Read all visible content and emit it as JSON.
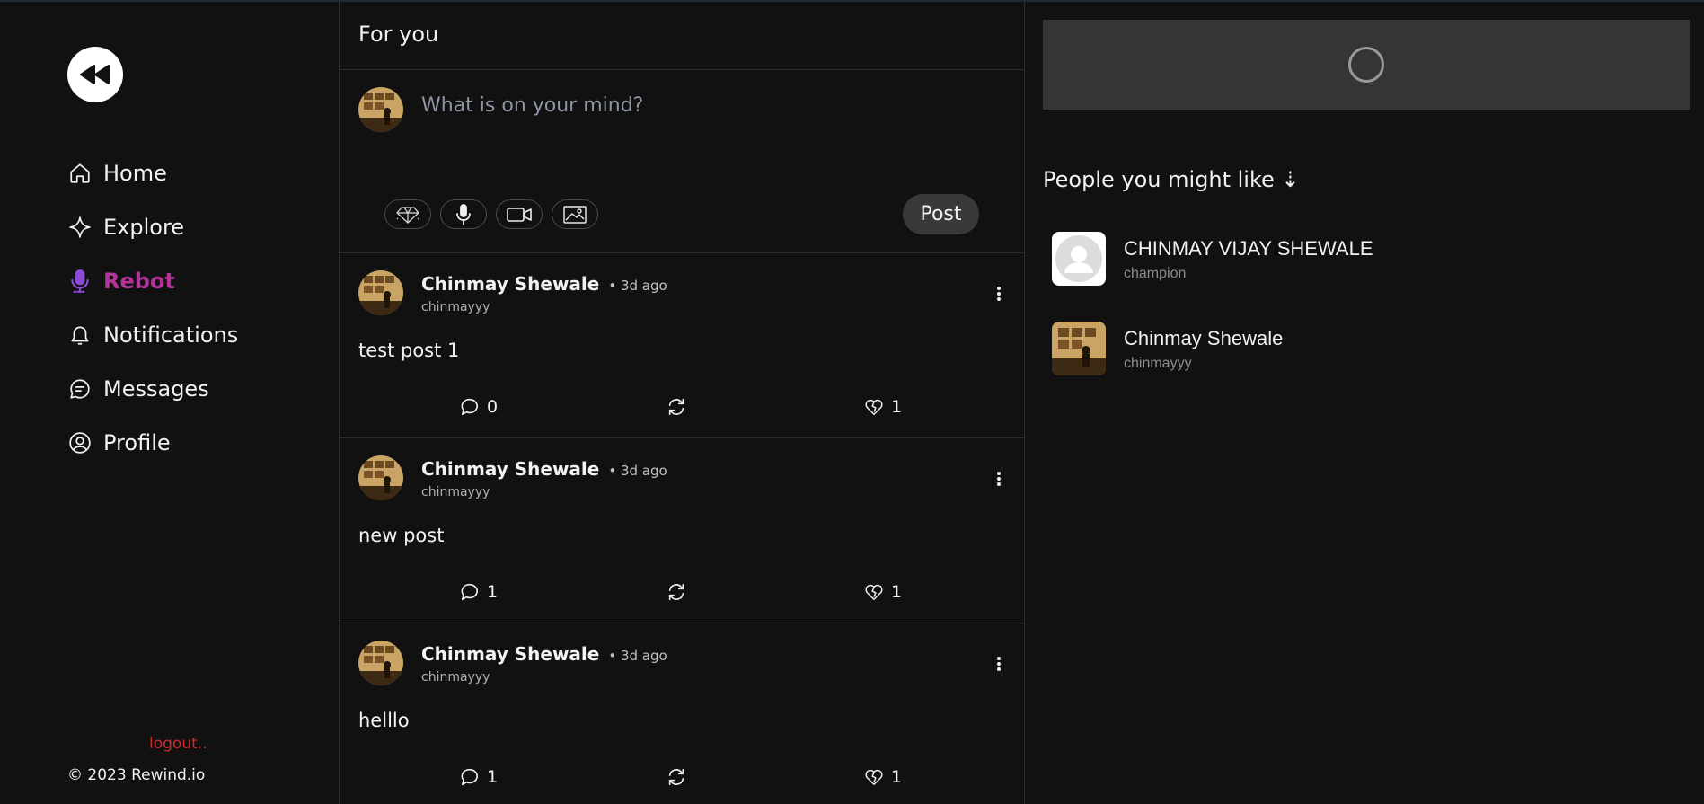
{
  "theme": {
    "background": "#111111",
    "accent": "#b3339a",
    "mic_accent": "#8a4bd6",
    "danger": "#d22a2a"
  },
  "sidebar": {
    "logo_icon": "rewind-icon",
    "items": [
      {
        "label": "Home",
        "icon": "home-icon",
        "active": false
      },
      {
        "label": "Explore",
        "icon": "sparkle-icon",
        "active": false
      },
      {
        "label": "Rebot",
        "icon": "microphone-icon",
        "active": true
      },
      {
        "label": "Notifications",
        "icon": "bell-icon",
        "active": false
      },
      {
        "label": "Messages",
        "icon": "message-icon",
        "active": false
      },
      {
        "label": "Profile",
        "icon": "user-circle-icon",
        "active": false
      }
    ],
    "logout_label": "logout..",
    "copyright": "© 2023 Rewind.io"
  },
  "feed": {
    "header_title": "For you",
    "composer": {
      "placeholder": "What is on your mind?",
      "tools": [
        "gem-icon",
        "microphone-icon",
        "video-icon",
        "image-icon"
      ],
      "post_label": "Post"
    },
    "posts": [
      {
        "name": "Chinmay Shewale",
        "time": "• 3d ago",
        "handle": "chinmayyy",
        "body": "test post 1",
        "comments": "0",
        "likes": "1"
      },
      {
        "name": "Chinmay Shewale",
        "time": "• 3d ago",
        "handle": "chinmayyy",
        "body": "new post",
        "comments": "1",
        "likes": "1"
      },
      {
        "name": "Chinmay Shewale",
        "time": "• 3d ago",
        "handle": "chinmayyy",
        "body": "helllo",
        "comments": "1",
        "likes": "1"
      }
    ]
  },
  "right": {
    "suggest_title": "People you might like ⇣",
    "people": [
      {
        "name": "CHINMAY VIJAY SHEWALE",
        "handle": "champion",
        "avatar": "default-avatar"
      },
      {
        "name": "Chinmay Shewale",
        "handle": "chinmayyy",
        "avatar": "photo-avatar"
      }
    ]
  }
}
